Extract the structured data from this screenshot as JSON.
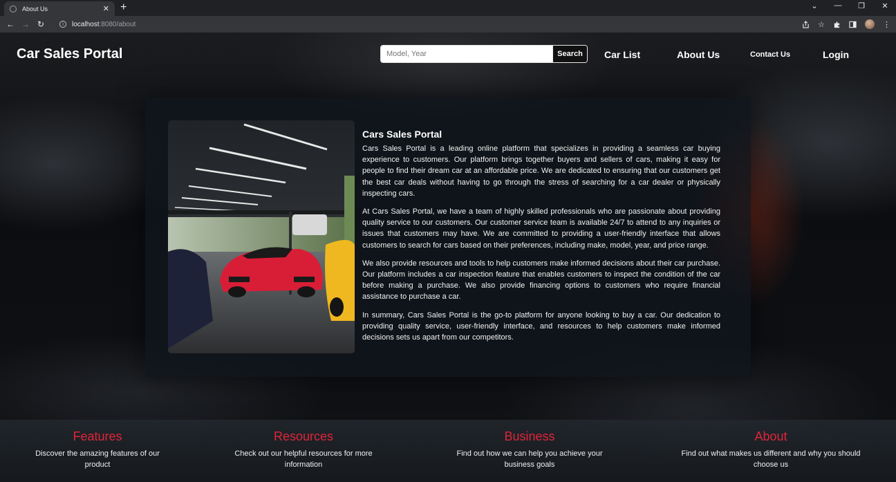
{
  "browser": {
    "tab_title": "About Us",
    "url_host": "localhost",
    "url_path": ":8080/about"
  },
  "nav": {
    "brand": "Car Sales Portal",
    "search_placeholder": "Model, Year",
    "search_button": "Search",
    "links": [
      "Car List",
      "About Us",
      "Contact Us",
      "Login"
    ]
  },
  "about": {
    "title": "Cars Sales Portal",
    "paragraphs": [
      "Cars Sales Portal is a leading online platform that specializes in providing a seamless car buying experience to customers. Our platform brings together buyers and sellers of cars, making it easy for people to find their dream car at an affordable price. We are dedicated to ensuring that our customers get the best car deals without having to go through the stress of searching for a car dealer or physically inspecting cars.",
      "At Cars Sales Portal, we have a team of highly skilled professionals who are passionate about providing quality service to our customers. Our customer service team is available 24/7 to attend to any inquiries or issues that customers may have. We are committed to providing a user-friendly interface that allows customers to search for cars based on their preferences, including make, model, year, and price range.",
      "We also provide resources and tools to help customers make informed decisions about their car purchase. Our platform includes a car inspection feature that enables customers to inspect the condition of the car before making a purchase. We also provide financing options to customers who require financial assistance to purchase a car.",
      "In summary, Cars Sales Portal is the go-to platform for anyone looking to buy a car. Our dedication to providing quality service, user-friendly interface, and resources to help customers make informed decisions sets us apart from our competitors."
    ]
  },
  "footer": {
    "features": {
      "title": "Features",
      "desc": "Discover the amazing features of our product"
    },
    "resources": {
      "title": "Resources",
      "desc": "Check out our helpful resources for more information"
    },
    "business": {
      "title": "Business",
      "desc": "Find out how we can help you achieve your business goals"
    },
    "about": {
      "title": "About",
      "desc": "Find out what makes us different and why you should choose us"
    }
  },
  "colors": {
    "accent": "#e0243a",
    "card_bg": "#10161c"
  },
  "icons": [
    "globe-icon",
    "close-icon",
    "plus-icon",
    "back-arrow-icon",
    "forward-arrow-icon",
    "reload-icon",
    "info-icon",
    "share-icon",
    "star-icon",
    "extensions-icon",
    "side-panel-icon",
    "menu-kebab-icon"
  ]
}
